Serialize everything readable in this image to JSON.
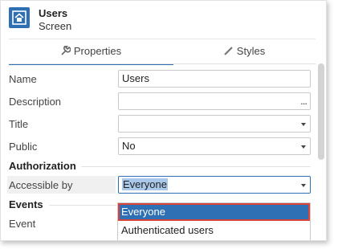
{
  "header": {
    "title": "Users",
    "subtitle": "Screen",
    "icon": "home-icon"
  },
  "tabs": [
    {
      "label": "Properties",
      "icon": "wrench-icon",
      "active": true
    },
    {
      "label": "Styles",
      "icon": "brush-icon",
      "active": false
    }
  ],
  "properties": {
    "name": {
      "label": "Name",
      "value": "Users"
    },
    "description": {
      "label": "Description",
      "value": "",
      "button": "..."
    },
    "title": {
      "label": "Title",
      "value": ""
    },
    "public": {
      "label": "Public",
      "value": "No"
    }
  },
  "authorization": {
    "section_label": "Authorization",
    "accessible_by": {
      "label": "Accessible by",
      "value": "Everyone"
    }
  },
  "events": {
    "section_label": "Events",
    "event": {
      "label": "Event"
    }
  },
  "dropdown": {
    "options": [
      "Everyone",
      "Authenticated users"
    ],
    "highlighted_index": 0
  },
  "colors": {
    "accent": "#2f6fb3",
    "highlight_border": "#d9433a"
  }
}
